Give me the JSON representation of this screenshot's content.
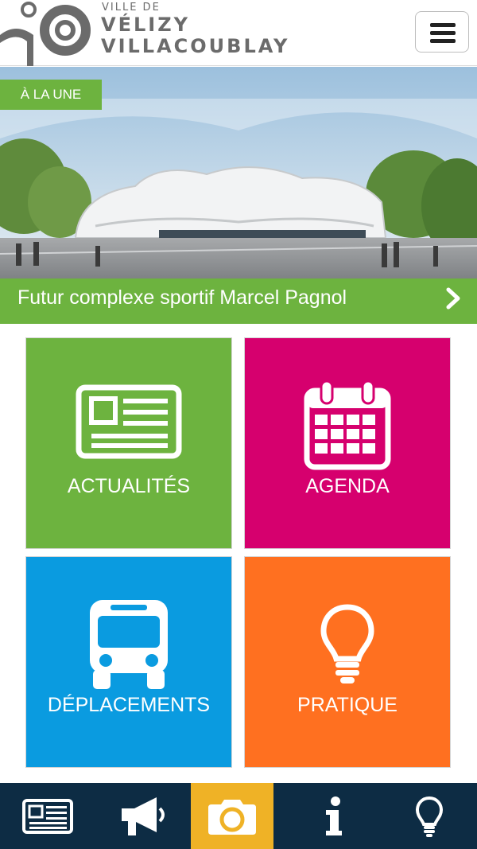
{
  "header": {
    "logo_small": "VILLE DE",
    "logo_line1": "VÉLIZY",
    "logo_line2": "VILLACOUBLAY"
  },
  "hero": {
    "tag": "À LA UNE",
    "caption": "Futur complexe sportif Marcel Pagnol"
  },
  "tiles": [
    {
      "label": "ACTUALITÉS",
      "icon": "newspaper-icon"
    },
    {
      "label": "AGENDA",
      "icon": "calendar-icon"
    },
    {
      "label": "DÉPLACEMENTS",
      "icon": "bus-icon"
    },
    {
      "label": "PRATIQUE",
      "icon": "lightbulb-icon"
    }
  ],
  "bottom_nav": [
    {
      "icon": "newspaper-icon",
      "active": false
    },
    {
      "icon": "megaphone-icon",
      "active": false
    },
    {
      "icon": "camera-icon",
      "active": true
    },
    {
      "icon": "info-icon",
      "active": false
    },
    {
      "icon": "lightbulb-icon",
      "active": false
    }
  ],
  "colors": {
    "green": "#6db33f",
    "magenta": "#d6006e",
    "blue": "#0a9be0",
    "orange": "#ff7020",
    "navy": "#0d2c44",
    "gold": "#efb226"
  }
}
